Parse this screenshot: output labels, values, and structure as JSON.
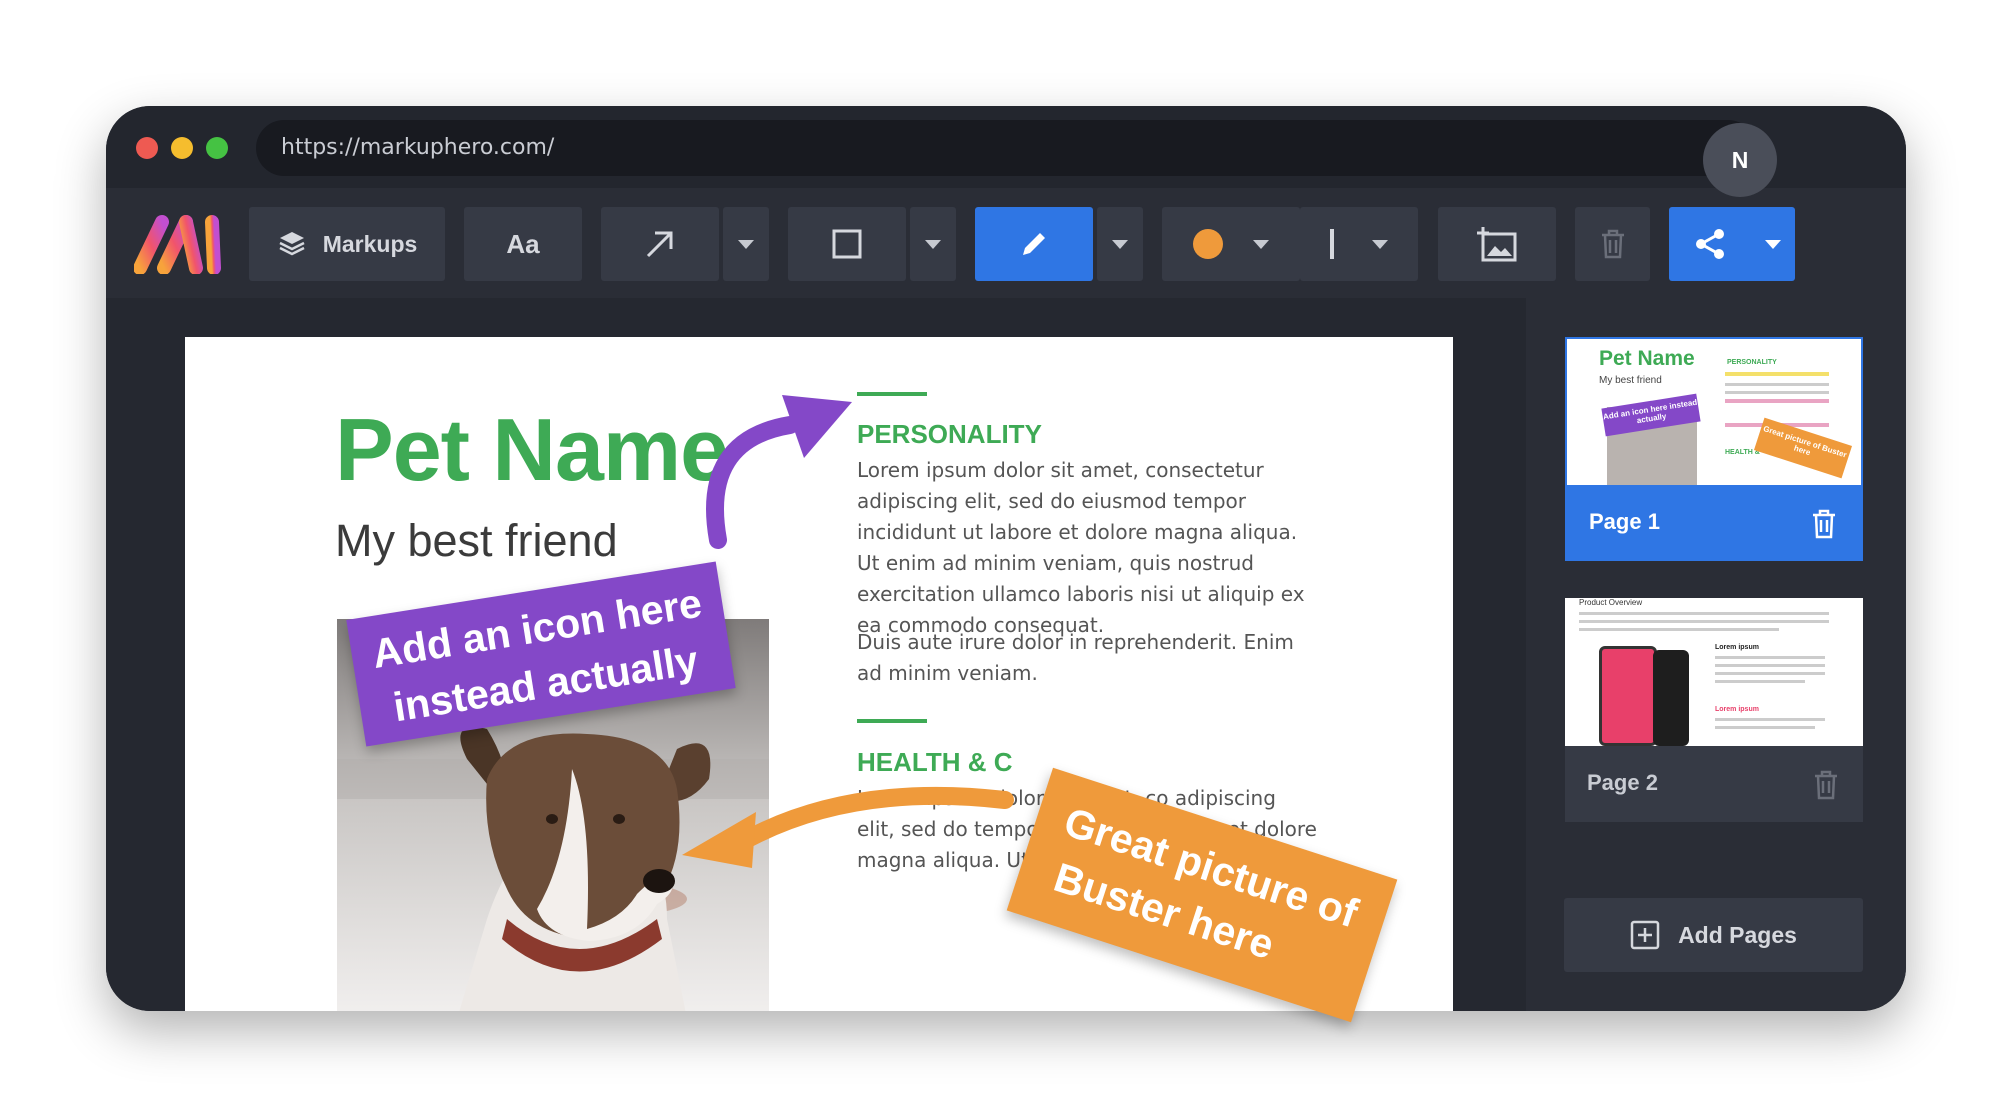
{
  "browser": {
    "url": "https://markuphero.com/",
    "traffic_lights": [
      "#ee5a52",
      "#f5bd2e",
      "#45c243"
    ]
  },
  "toolbar": {
    "logo": "markuphero-logo",
    "markups_label": "Markups",
    "text_tool_label": "Aa",
    "active_color": "#ef9a3b",
    "accent": "#2f76e4"
  },
  "user": {
    "avatar_initial": "N"
  },
  "document": {
    "title": "Pet Name",
    "subtitle": "My best friend",
    "sections": [
      {
        "heading": "PERSONALITY",
        "paragraphs": [
          "Lorem ipsum dolor sit amet, consectetur adipiscing elit, sed do eiusmod tempor incididunt ut labore et dolore magna aliqua. Ut enim ad minim veniam, quis nostrud exercitation ullamco laboris nisi ut aliquip ex ea commodo consequat.",
          "Duis aute irure dolor in reprehenderit. Enim ad minim veniam."
        ]
      },
      {
        "heading": "HEALTH & C",
        "paragraphs": [
          "Lorem ipsum dolor sit amet, co adipiscing elit, sed do tempor incididunt labore et dolore magna aliqua. Ut enim ad"
        ]
      }
    ]
  },
  "annotations": {
    "purple_note": {
      "line1": "Add an icon here",
      "line2": "instead actually",
      "color": "#8448c8"
    },
    "orange_note": {
      "line1": "Great picture of",
      "line2": "Buster here",
      "color": "#ef9a3b"
    }
  },
  "pages": [
    {
      "label": "Page 1",
      "active": true,
      "thumb_title": "Pet Name",
      "thumb_subtitle": "My best friend",
      "thumb_heading": "PERSONALITY",
      "thumb_heading2": "HEALTH &",
      "thumb_note1": "Add an icon here instead actually",
      "thumb_note2": "Great picture of Buster here"
    },
    {
      "label": "Page 2",
      "active": false,
      "thumb_title": "Product Overview",
      "thumb_heading": "Lorem ipsum",
      "thumb_heading2": "Lorem ipsum"
    }
  ],
  "add_pages_label": "Add Pages"
}
